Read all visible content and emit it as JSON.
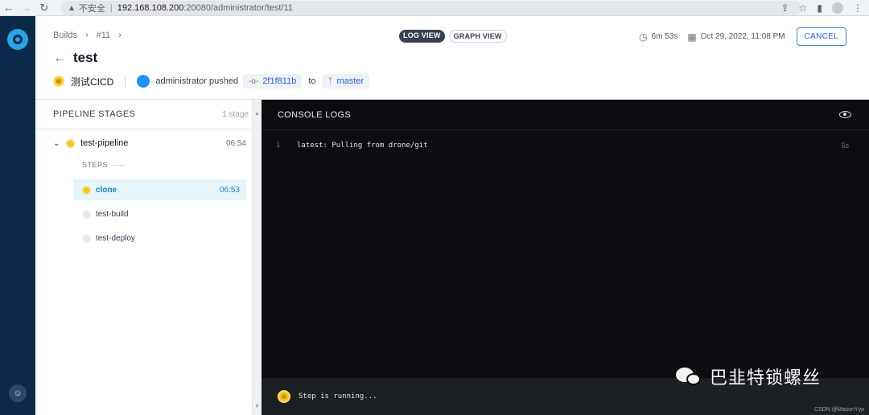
{
  "browser": {
    "warning_icon": "▲",
    "insecure_label": "不安全",
    "separator": "|",
    "url_host": "192.168.108.200",
    "url_path": ":20080/administrator/test/11"
  },
  "breadcrumb": {
    "builds": "Builds",
    "build_number": "#11"
  },
  "header": {
    "title": "test",
    "repo_name": "测试CICD",
    "author": "administrator pushed",
    "commit": "2f1f811b",
    "to_label": "to",
    "branch": "master",
    "duration": "6m 53s",
    "date": "Oct 29, 2022, 11:08 PM",
    "cancel_label": "CANCEL"
  },
  "view_toggle": {
    "log_view": "LOG VIEW",
    "graph_view": "GRAPH VIEW"
  },
  "stages": {
    "heading": "PIPELINE STAGES",
    "count": "1 stage",
    "items": [
      {
        "name": "test-pipeline",
        "time": "06:54",
        "steps_label": "STEPS",
        "steps": [
          {
            "name": "clone",
            "time": "06:53",
            "status": "running"
          },
          {
            "name": "test-build",
            "time": "",
            "status": "pending"
          },
          {
            "name": "test-deploy",
            "time": "",
            "status": "pending"
          }
        ]
      }
    ]
  },
  "console": {
    "heading": "CONSOLE LOGS",
    "lines": [
      {
        "num": "1",
        "text": "latest: Pulling from drone/git",
        "duration": "5s"
      }
    ],
    "footer_message": "Step is running..."
  },
  "watermark": {
    "text": "巴韭特锁螺丝",
    "credit": "CSDN @MasonYyp"
  },
  "colors": {
    "running": "#f5c518",
    "rail": "#0b2a4a",
    "console_bg": "#0b0d10",
    "accent": "#2563eb"
  }
}
